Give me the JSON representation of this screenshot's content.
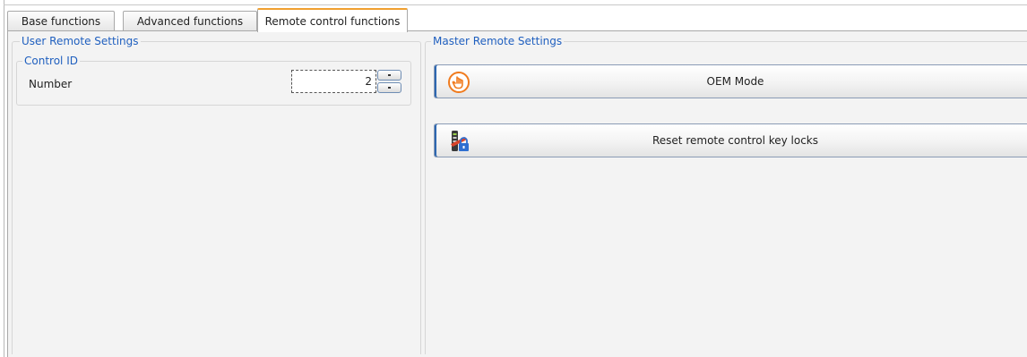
{
  "tabs": [
    {
      "label": "Base functions",
      "active": false
    },
    {
      "label": "Advanced functions",
      "active": false
    },
    {
      "label": "Remote control functions",
      "active": true
    }
  ],
  "user_remote": {
    "title": "User Remote Settings",
    "control_id": {
      "title": "Control ID",
      "number_label": "Number",
      "number_value": "2"
    }
  },
  "master_remote": {
    "title": "Master Remote Settings",
    "oem_button": {
      "label": "OEM Mode",
      "icon": "hand-pointer-icon"
    },
    "reset_button": {
      "label": "Reset remote control key locks",
      "icon": "remote-lock-icon"
    }
  },
  "colors": {
    "group_title": "#1f5fbf",
    "active_tab_accent": "#f0a030",
    "oem_icon": "#f07b1e",
    "lock_icon": "#2f6fd0"
  }
}
